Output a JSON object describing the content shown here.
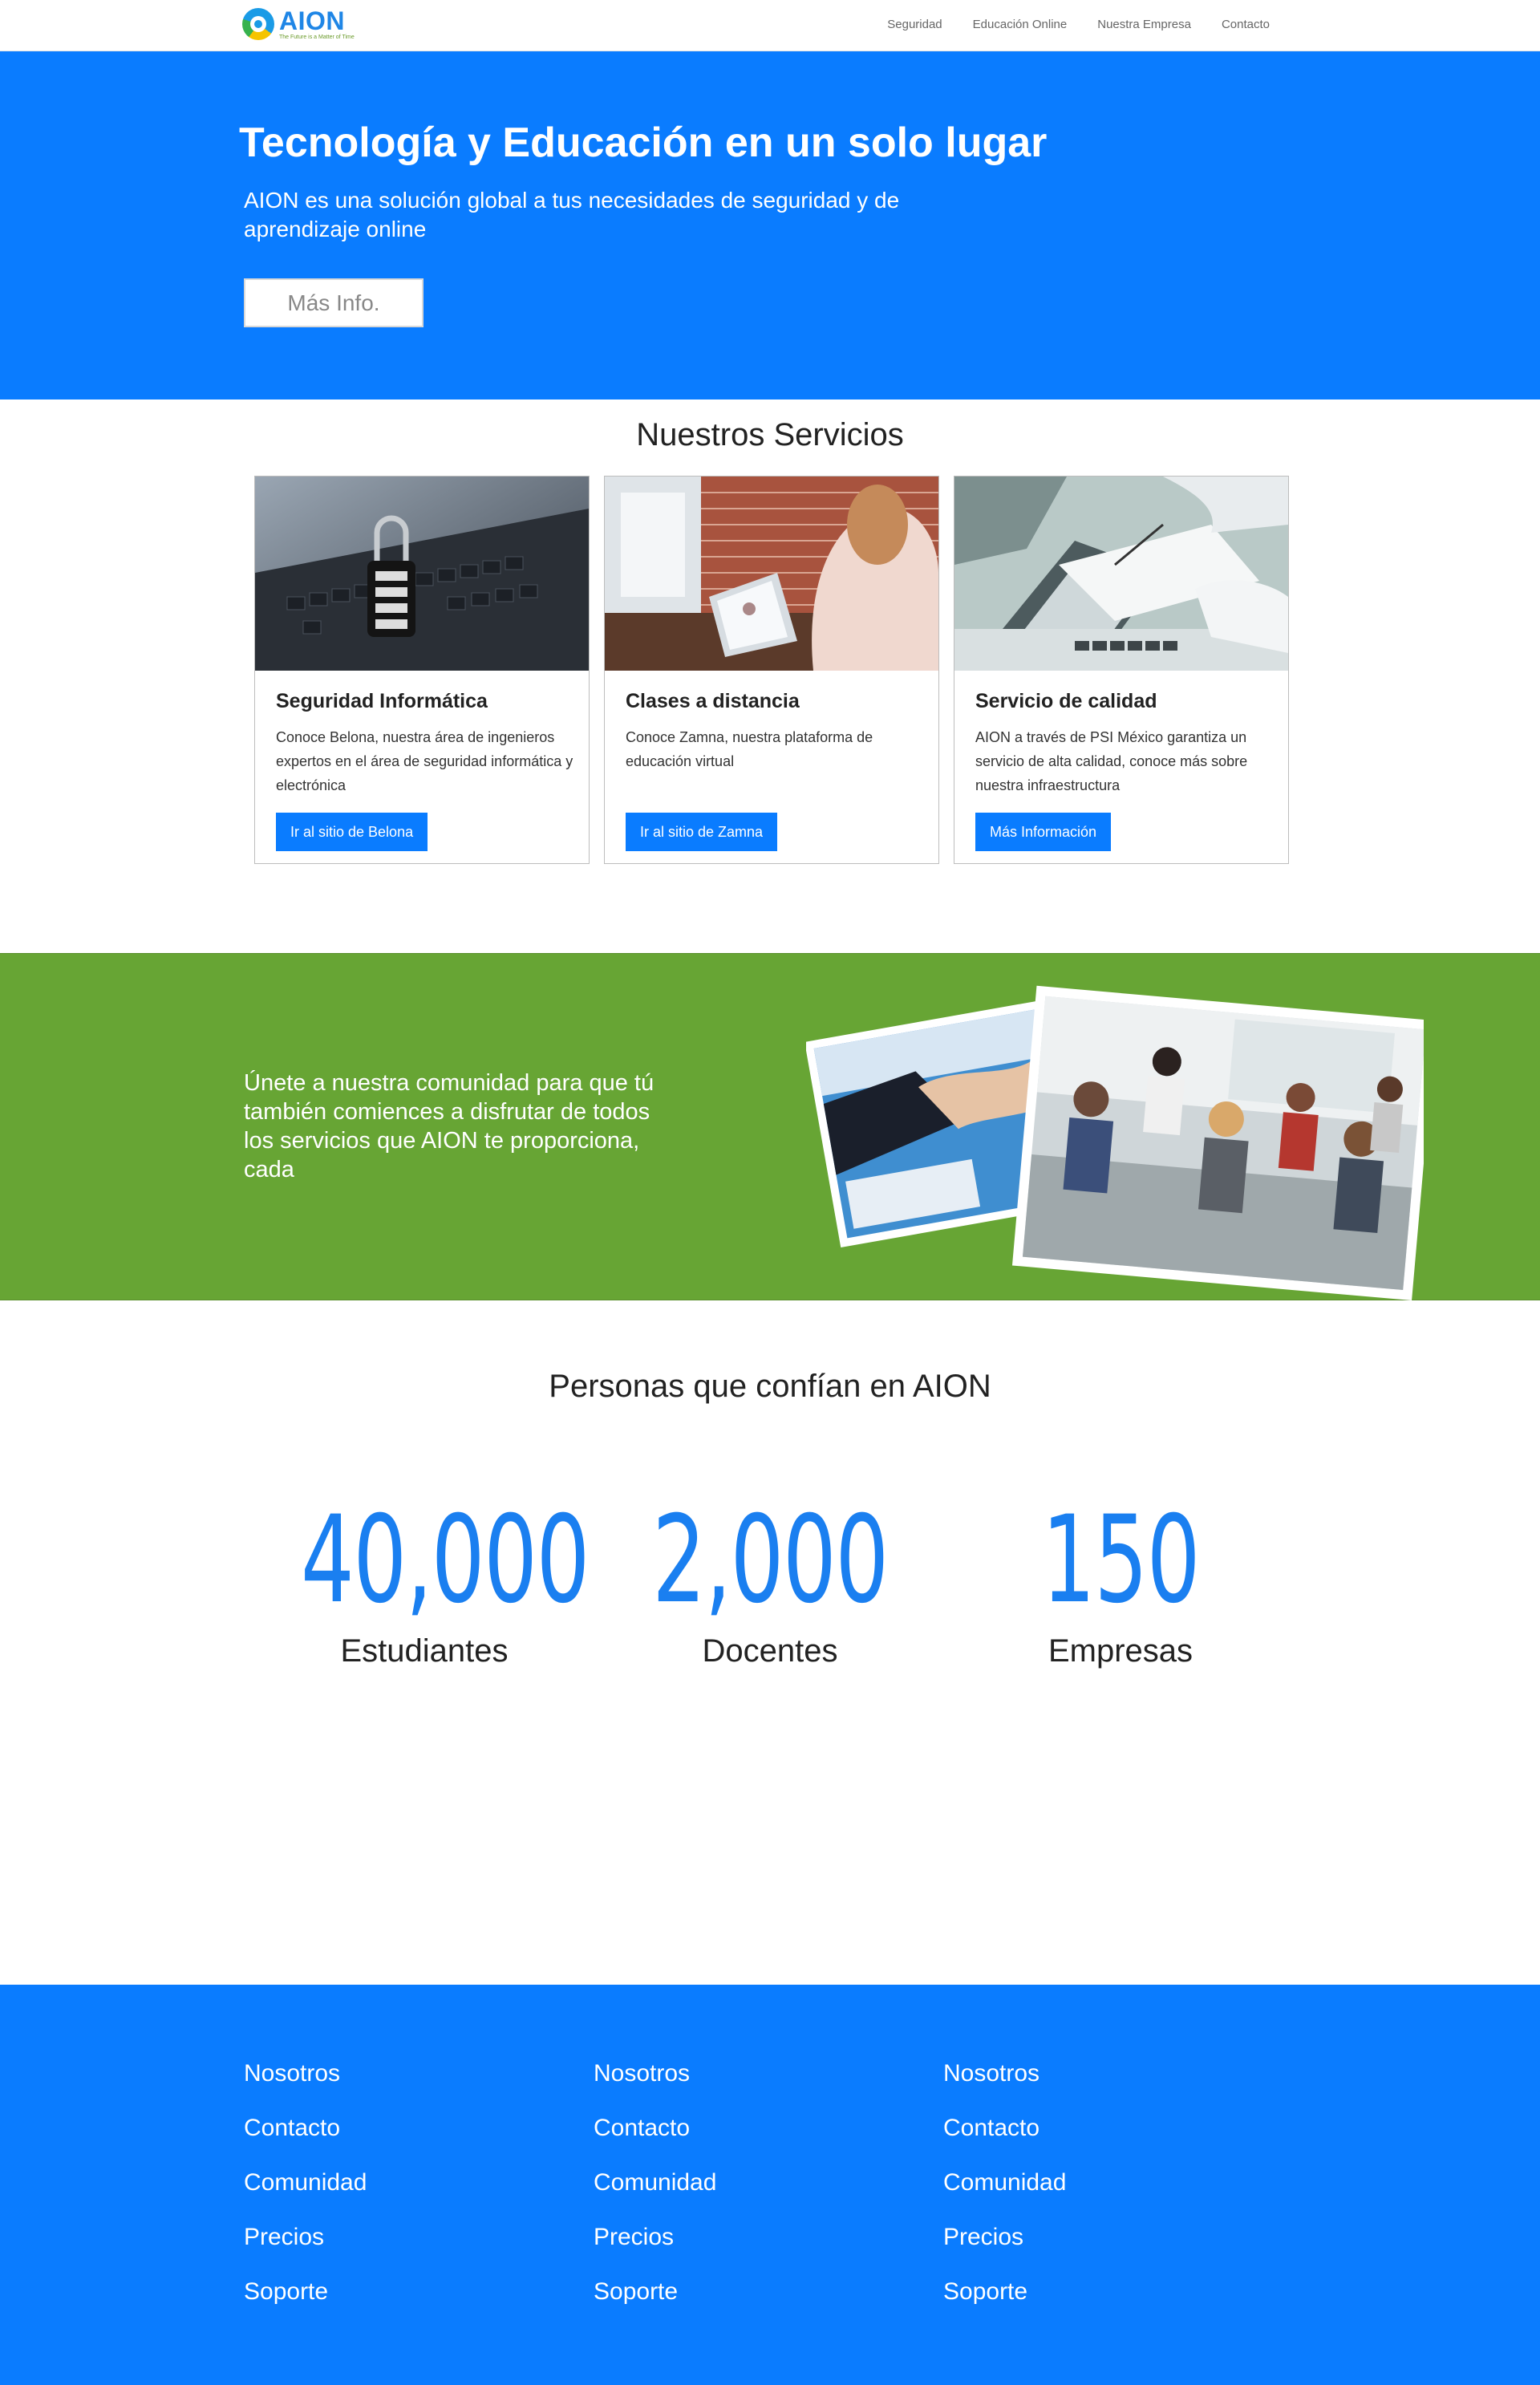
{
  "nav": {
    "logo_name": "AION",
    "logo_tagline": "The Future is a Matter of Time",
    "links": [
      "Seguridad",
      "Educación Online",
      "Nuestra Empresa",
      "Contacto"
    ]
  },
  "hero": {
    "title": "Tecnología y Educación en un solo lugar",
    "subtitle": "AION es una solución global a tus necesidades de seguridad y de aprendizaje online",
    "button": "Más Info."
  },
  "services": {
    "title": "Nuestros Servicios",
    "cards": [
      {
        "title": "Seguridad Informática",
        "text": "Conoce Belona, nuestra área de ingenieros expertos en el área de seguridad informática y electrónica",
        "button": "Ir al sitio de Belona"
      },
      {
        "title": "Clases a distancia",
        "text": "Conoce Zamna, nuestra plataforma de educación virtual",
        "button": "Ir al sitio de Zamna"
      },
      {
        "title": "Servicio de calidad",
        "text": "AION a través de PSI México garantiza un servicio de alta calidad, conoce más sobre nuestra infraestructura",
        "button": "Más Información"
      }
    ]
  },
  "community": {
    "text": "Únete a nuestra comunidad para que tú también comiences a disfrutar de todos los servicios que AION te proporciona, cada"
  },
  "stats": {
    "title": "Personas que confían en AION",
    "items": [
      {
        "value": "40,000",
        "label": "Estudiantes"
      },
      {
        "value": "2,000",
        "label": "Docentes"
      },
      {
        "value": "150",
        "label": "Empresas"
      }
    ]
  },
  "footer": {
    "columns": [
      [
        "Nosotros",
        "Contacto",
        "Comunidad",
        "Precios",
        "Soporte"
      ],
      [
        "Nosotros",
        "Contacto",
        "Comunidad",
        "Precios",
        "Soporte"
      ],
      [
        "Nosotros",
        "Contacto",
        "Comunidad",
        "Precios",
        "Soporte"
      ]
    ]
  },
  "colors": {
    "primary": "#0a7cff",
    "green": "#67a534",
    "stat": "#1a7ff0"
  }
}
